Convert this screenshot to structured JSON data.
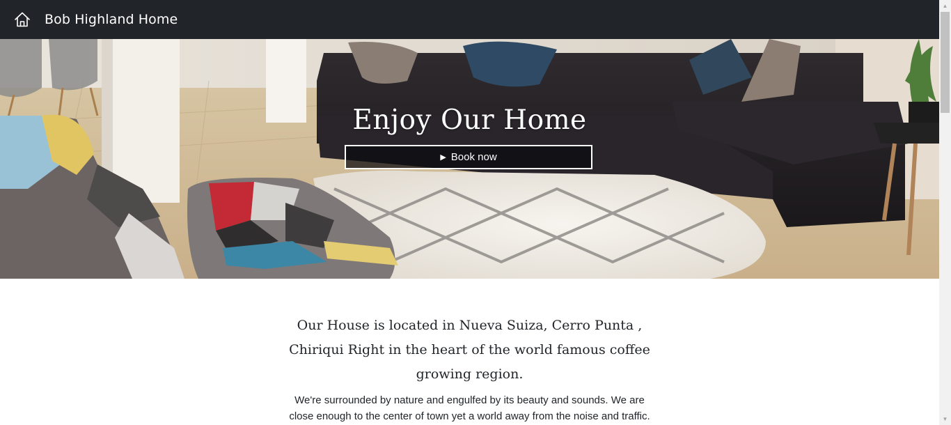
{
  "navbar": {
    "home_icon": "home-icon",
    "brand": "Bob Highland Home",
    "background": "#212529"
  },
  "hero": {
    "title": "Enjoy Our Home",
    "book_button": {
      "icon": "play-icon",
      "label": "Book now"
    }
  },
  "intro": {
    "heading": "Our House is located in Nueva Suiza, Cerro Punta , Chiriqui Right in the heart of the world famous coffee growing region.",
    "body": "We're surrounded by nature and engulfed by its beauty and sounds. We are close enough to the center of town yet a world away from the noise and traffic."
  }
}
